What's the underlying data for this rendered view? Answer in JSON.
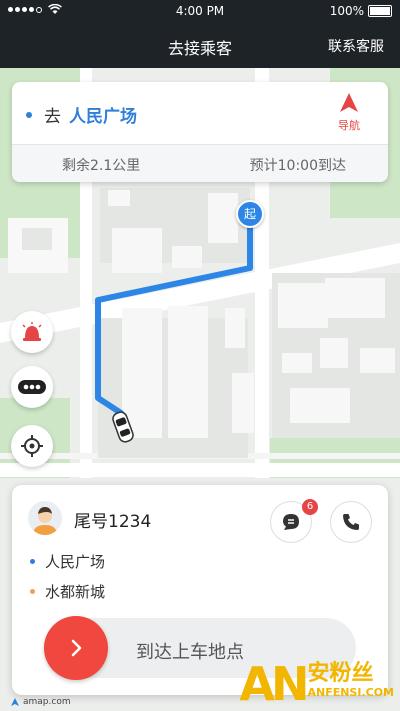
{
  "status_bar": {
    "time": "4:00 PM",
    "battery": "100%"
  },
  "header": {
    "title": "去接乘客",
    "service_label": "联系客服"
  },
  "destination_card": {
    "prefix": "去",
    "destination": "人民广场",
    "nav_label": "导航",
    "remaining": "剩余2.1公里",
    "eta": "预计10:00到达"
  },
  "map": {
    "start_marker": "起",
    "route_color": "#2d86e6"
  },
  "passenger": {
    "name": "尾号1234",
    "unread_count": "6",
    "pickup": "人民广场",
    "dropoff": "水都新城"
  },
  "action": {
    "slider_label": "到达上车地点"
  },
  "footer": {
    "map_brand": "amap.com"
  },
  "watermark": {
    "letters": "AN",
    "cn": "安粉丝",
    "en": "ANFENSI.COM"
  },
  "icons": [
    "alarm-icon",
    "more-icon",
    "locate-icon",
    "chat-icon",
    "phone-icon",
    "navigation-arrow-icon",
    "car-icon",
    "arrow-right-icon"
  ],
  "colors": {
    "accent_blue": "#2e7fd8",
    "alert_red": "#e64545",
    "pickup_dot": "#2e7fd8",
    "dropoff_dot": "#f0a050"
  }
}
